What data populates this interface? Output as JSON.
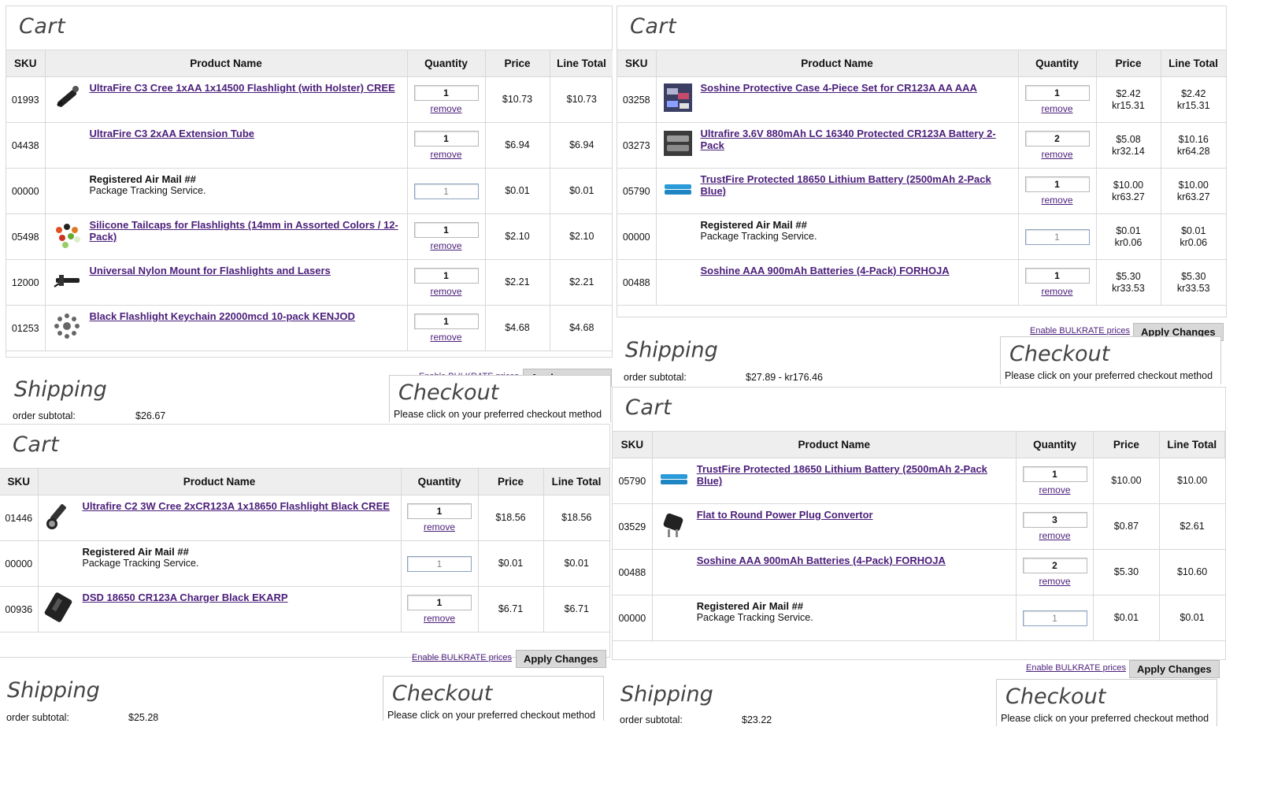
{
  "headers": {
    "sku": "SKU",
    "name": "Product Name",
    "qty": "Quantity",
    "price": "Price",
    "total": "Line Total"
  },
  "common": {
    "cart_title": "Cart",
    "remove": "remove",
    "bulkrate": "Enable BULKRATE prices",
    "apply": "Apply Changes",
    "shipping": "Shipping",
    "subtotal_label": "order subtotal:",
    "checkout": "Checkout",
    "checkout_sub": "Please click on your preferred checkout method"
  },
  "carts": [
    {
      "subtotal": "$26.67",
      "rows": [
        {
          "sku": "01993",
          "name": "UltraFire C3 Cree 1xAA 1x14500 Flashlight (with Holster) CREE",
          "link": true,
          "thumb": "flashlight-holster-icon",
          "qty": "1",
          "price": "$10.73",
          "total": "$10.73"
        },
        {
          "sku": "04438",
          "name": "UltraFire C3 2xAA Extension Tube",
          "link": true,
          "thumb": "",
          "qty": "1",
          "price": "$6.94",
          "total": "$6.94"
        },
        {
          "sku": "00000",
          "name": "Registered Air Mail ##",
          "sub": "Package Tracking Service.",
          "link": false,
          "thumb": "",
          "qty": "1",
          "price": "$0.01",
          "total": "$0.01"
        },
        {
          "sku": "05498",
          "name": "Silicone Tailcaps for Flashlights (14mm in Assorted Colors / 12-Pack)",
          "link": true,
          "thumb": "tailcaps-icon",
          "qty": "1",
          "price": "$2.10",
          "total": "$2.10"
        },
        {
          "sku": "12000",
          "name": "Universal Nylon Mount for Flashlights and Lasers",
          "link": true,
          "thumb": "mount-icon",
          "qty": "1",
          "price": "$2.21",
          "total": "$2.21"
        },
        {
          "sku": "01253",
          "name": "Black Flashlight Keychain 22000mcd 10-pack KENJOD",
          "link": true,
          "thumb": "keychain-icon",
          "qty": "1",
          "price": "$4.68",
          "total": "$4.68"
        }
      ]
    },
    {
      "subtotal": "$27.89 - kr176.46",
      "rows": [
        {
          "sku": "03258",
          "name": "Soshine Protective Case 4-Piece Set for CR123A AA AAA",
          "link": true,
          "thumb": "battery-case-icon",
          "qty": "1",
          "price": "$2.42",
          "price2": "kr15.31",
          "total": "$2.42",
          "total2": "kr15.31"
        },
        {
          "sku": "03273",
          "name": "Ultrafire 3.6V 880mAh LC 16340 Protected CR123A Battery 2-Pack",
          "link": true,
          "thumb": "battery-pack-icon",
          "qty": "2",
          "price": "$5.08",
          "price2": "kr32.14",
          "total": "$10.16",
          "total2": "kr64.28"
        },
        {
          "sku": "05790",
          "name": "TrustFire Protected 18650 Lithium Battery (2500mAh 2-Pack Blue)",
          "link": true,
          "thumb": "blue-battery-icon",
          "qty": "1",
          "price": "$10.00",
          "price2": "kr63.27",
          "total": "$10.00",
          "total2": "kr63.27"
        },
        {
          "sku": "00000",
          "name": "Registered Air Mail ##",
          "sub": "Package Tracking Service.",
          "link": false,
          "thumb": "",
          "qty": "1",
          "price": "$0.01",
          "price2": "kr0.06",
          "total": "$0.01",
          "total2": "kr0.06"
        },
        {
          "sku": "00488",
          "name": "Soshine AAA 900mAh Batteries (4-Pack) FORHOJA",
          "link": true,
          "thumb": "",
          "qty": "1",
          "price": "$5.30",
          "price2": "kr33.53",
          "total": "$5.30",
          "total2": "kr33.53"
        }
      ]
    },
    {
      "subtotal": "$25.28",
      "rows": [
        {
          "sku": "01446",
          "name": "Ultrafire C2 3W Cree 2xCR123A 1x18650 Flashlight Black CREE",
          "link": true,
          "thumb": "flashlight-icon",
          "qty": "1",
          "price": "$18.56",
          "total": "$18.56"
        },
        {
          "sku": "00000",
          "name": "Registered Air Mail ##",
          "sub": "Package Tracking Service.",
          "link": false,
          "thumb": "",
          "qty": "1",
          "price": "$0.01",
          "total": "$0.01"
        },
        {
          "sku": "00936",
          "name": "DSD 18650 CR123A Charger Black EKARP",
          "link": true,
          "thumb": "charger-icon",
          "qty": "1",
          "price": "$6.71",
          "total": "$6.71"
        }
      ]
    },
    {
      "subtotal": "$23.22",
      "rows": [
        {
          "sku": "05790",
          "name": "TrustFire Protected 18650 Lithium Battery (2500mAh 2-Pack Blue)",
          "link": true,
          "thumb": "blue-battery-icon",
          "qty": "1",
          "price": "$10.00",
          "total": "$10.00"
        },
        {
          "sku": "03529",
          "name": "Flat to Round Power Plug Convertor",
          "link": true,
          "thumb": "plug-icon",
          "qty": "3",
          "price": "$0.87",
          "total": "$2.61"
        },
        {
          "sku": "00488",
          "name": "Soshine AAA 900mAh Batteries (4-Pack) FORHOJA",
          "link": true,
          "thumb": "",
          "qty": "2",
          "price": "$5.30",
          "total": "$10.60"
        },
        {
          "sku": "00000",
          "name": "Registered Air Mail ##",
          "sub": "Package Tracking Service.",
          "link": false,
          "thumb": "",
          "qty": "1",
          "price": "$0.01",
          "total": "$0.01"
        }
      ]
    }
  ]
}
